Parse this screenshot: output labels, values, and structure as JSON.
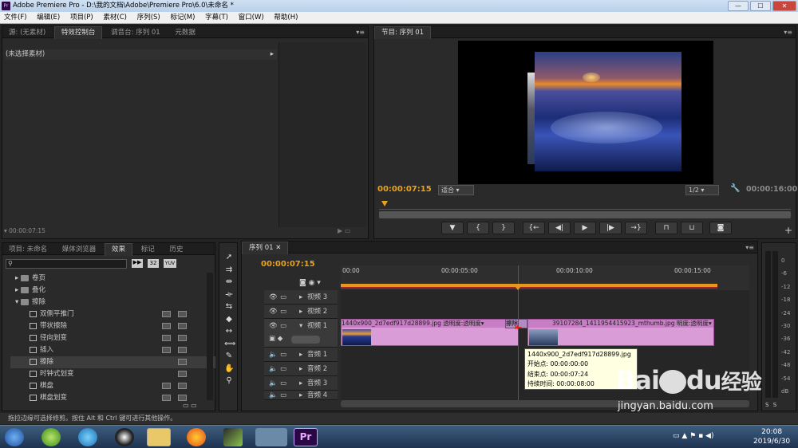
{
  "window": {
    "title": "Adobe Premiere Pro - D:\\我的文档\\Adobe\\Premiere Pro\\6.0\\未命名 *",
    "min": "—",
    "max": "☐",
    "close": "✕"
  },
  "menu": [
    "文件(F)",
    "编辑(E)",
    "项目(P)",
    "素材(C)",
    "序列(S)",
    "标记(M)",
    "字幕(T)",
    "窗口(W)",
    "帮助(H)"
  ],
  "source_panel": {
    "tabs": [
      "源: (无素材)",
      "特效控制台",
      "调音台: 序列 01",
      "元数据"
    ],
    "active_tab": 1,
    "label": "(未选择素材)",
    "timecode": "00:00:07:15"
  },
  "program": {
    "tab": "节目: 序列 01",
    "timecode": "00:00:07:15",
    "fit": "适合",
    "quality": "1/2",
    "duration": "00:00:16:00"
  },
  "project": {
    "tabs": [
      "项目: 未命名",
      "媒体浏览器",
      "效果",
      "标记",
      "历史"
    ],
    "active_tab": 2,
    "search_placeholder": "",
    "badges": [
      "32",
      "YUV"
    ],
    "effects": [
      {
        "label": "卷页",
        "kind": "folder",
        "open": false
      },
      {
        "label": "叠化",
        "kind": "folder",
        "open": false
      },
      {
        "label": "擦除",
        "kind": "folder",
        "open": true
      },
      {
        "label": "双侧平推门",
        "kind": "item"
      },
      {
        "label": "带状擦除",
        "kind": "item"
      },
      {
        "label": "径向划变",
        "kind": "item"
      },
      {
        "label": "插入",
        "kind": "item"
      },
      {
        "label": "擦除",
        "kind": "item",
        "selected": true
      },
      {
        "label": "时钟式划变",
        "kind": "item"
      },
      {
        "label": "棋盘",
        "kind": "item"
      },
      {
        "label": "棋盘划变",
        "kind": "item"
      }
    ]
  },
  "sequence": {
    "tab": "序列 01",
    "timecode": "00:00:07:15",
    "ruler": [
      "00:00",
      "00:00:05:00",
      "00:00:10:00",
      "00:00:15:00"
    ],
    "tracks": [
      {
        "name": "视频 3",
        "type": "video"
      },
      {
        "name": "视频 2",
        "type": "video"
      },
      {
        "name": "视频 1",
        "type": "video"
      },
      {
        "name": "音频 1",
        "type": "audio"
      },
      {
        "name": "音频 2",
        "type": "audio"
      },
      {
        "name": "音频 3",
        "type": "audio"
      },
      {
        "name": "音频 4",
        "type": "audio"
      }
    ],
    "clip1": {
      "name": "1440x900_2d7edf917d28899.jpg",
      "fx": "透明度:透明度"
    },
    "transition": "擦除",
    "clip2": {
      "name": "39107284_1411954415923_mthumb.jpg",
      "fx": "明度:透明度"
    },
    "tooltip": [
      "1440x900_2d7edf917d28899.jpg",
      "开始点: 00:00:00:00",
      "结束点: 00:00:07:24",
      "持续时间: 00:00:08:00"
    ]
  },
  "meters": {
    "scale": [
      "0",
      "-6",
      "-12",
      "-18",
      "-24",
      "-30",
      "-36",
      "-42",
      "-48",
      "-54",
      "dB"
    ],
    "solo": [
      "S",
      "S"
    ]
  },
  "status": "拖拉边缘可选择修剪。按住 Alt 和 Ctrl 键可进行其他操作。",
  "taskbar": {
    "time": "20:08",
    "date": "2019/6/30",
    "pr": "Pr"
  },
  "watermark": {
    "brand": "Bai",
    "du": "du",
    "cn": "经验",
    "url": "jingyan.baidu.com"
  }
}
